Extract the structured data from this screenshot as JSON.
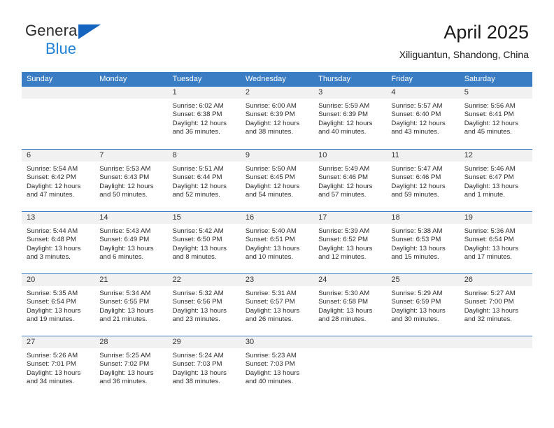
{
  "brand": {
    "line1": "General",
    "line2": "Blue",
    "triangle_color": "#1565c0",
    "blue_color": "#1f82d6"
  },
  "header": {
    "title": "April 2025",
    "subtitle": "Xiliguantun, Shandong, China"
  },
  "theme": {
    "header_blue": "#3b7dc4",
    "daynum_band": "#f1f1f1",
    "text": "#1a1a1a"
  },
  "weekdays": [
    "Sunday",
    "Monday",
    "Tuesday",
    "Wednesday",
    "Thursday",
    "Friday",
    "Saturday"
  ],
  "weeks": [
    [
      {
        "day": "",
        "lines": []
      },
      {
        "day": "",
        "lines": []
      },
      {
        "day": "1",
        "lines": [
          "Sunrise: 6:02 AM",
          "Sunset: 6:38 PM",
          "Daylight: 12 hours",
          "and 36 minutes."
        ]
      },
      {
        "day": "2",
        "lines": [
          "Sunrise: 6:00 AM",
          "Sunset: 6:39 PM",
          "Daylight: 12 hours",
          "and 38 minutes."
        ]
      },
      {
        "day": "3",
        "lines": [
          "Sunrise: 5:59 AM",
          "Sunset: 6:39 PM",
          "Daylight: 12 hours",
          "and 40 minutes."
        ]
      },
      {
        "day": "4",
        "lines": [
          "Sunrise: 5:57 AM",
          "Sunset: 6:40 PM",
          "Daylight: 12 hours",
          "and 43 minutes."
        ]
      },
      {
        "day": "5",
        "lines": [
          "Sunrise: 5:56 AM",
          "Sunset: 6:41 PM",
          "Daylight: 12 hours",
          "and 45 minutes."
        ]
      }
    ],
    [
      {
        "day": "6",
        "lines": [
          "Sunrise: 5:54 AM",
          "Sunset: 6:42 PM",
          "Daylight: 12 hours",
          "and 47 minutes."
        ]
      },
      {
        "day": "7",
        "lines": [
          "Sunrise: 5:53 AM",
          "Sunset: 6:43 PM",
          "Daylight: 12 hours",
          "and 50 minutes."
        ]
      },
      {
        "day": "8",
        "lines": [
          "Sunrise: 5:51 AM",
          "Sunset: 6:44 PM",
          "Daylight: 12 hours",
          "and 52 minutes."
        ]
      },
      {
        "day": "9",
        "lines": [
          "Sunrise: 5:50 AM",
          "Sunset: 6:45 PM",
          "Daylight: 12 hours",
          "and 54 minutes."
        ]
      },
      {
        "day": "10",
        "lines": [
          "Sunrise: 5:49 AM",
          "Sunset: 6:46 PM",
          "Daylight: 12 hours",
          "and 57 minutes."
        ]
      },
      {
        "day": "11",
        "lines": [
          "Sunrise: 5:47 AM",
          "Sunset: 6:46 PM",
          "Daylight: 12 hours",
          "and 59 minutes."
        ]
      },
      {
        "day": "12",
        "lines": [
          "Sunrise: 5:46 AM",
          "Sunset: 6:47 PM",
          "Daylight: 13 hours",
          "and 1 minute."
        ]
      }
    ],
    [
      {
        "day": "13",
        "lines": [
          "Sunrise: 5:44 AM",
          "Sunset: 6:48 PM",
          "Daylight: 13 hours",
          "and 3 minutes."
        ]
      },
      {
        "day": "14",
        "lines": [
          "Sunrise: 5:43 AM",
          "Sunset: 6:49 PM",
          "Daylight: 13 hours",
          "and 6 minutes."
        ]
      },
      {
        "day": "15",
        "lines": [
          "Sunrise: 5:42 AM",
          "Sunset: 6:50 PM",
          "Daylight: 13 hours",
          "and 8 minutes."
        ]
      },
      {
        "day": "16",
        "lines": [
          "Sunrise: 5:40 AM",
          "Sunset: 6:51 PM",
          "Daylight: 13 hours",
          "and 10 minutes."
        ]
      },
      {
        "day": "17",
        "lines": [
          "Sunrise: 5:39 AM",
          "Sunset: 6:52 PM",
          "Daylight: 13 hours",
          "and 12 minutes."
        ]
      },
      {
        "day": "18",
        "lines": [
          "Sunrise: 5:38 AM",
          "Sunset: 6:53 PM",
          "Daylight: 13 hours",
          "and 15 minutes."
        ]
      },
      {
        "day": "19",
        "lines": [
          "Sunrise: 5:36 AM",
          "Sunset: 6:54 PM",
          "Daylight: 13 hours",
          "and 17 minutes."
        ]
      }
    ],
    [
      {
        "day": "20",
        "lines": [
          "Sunrise: 5:35 AM",
          "Sunset: 6:54 PM",
          "Daylight: 13 hours",
          "and 19 minutes."
        ]
      },
      {
        "day": "21",
        "lines": [
          "Sunrise: 5:34 AM",
          "Sunset: 6:55 PM",
          "Daylight: 13 hours",
          "and 21 minutes."
        ]
      },
      {
        "day": "22",
        "lines": [
          "Sunrise: 5:32 AM",
          "Sunset: 6:56 PM",
          "Daylight: 13 hours",
          "and 23 minutes."
        ]
      },
      {
        "day": "23",
        "lines": [
          "Sunrise: 5:31 AM",
          "Sunset: 6:57 PM",
          "Daylight: 13 hours",
          "and 26 minutes."
        ]
      },
      {
        "day": "24",
        "lines": [
          "Sunrise: 5:30 AM",
          "Sunset: 6:58 PM",
          "Daylight: 13 hours",
          "and 28 minutes."
        ]
      },
      {
        "day": "25",
        "lines": [
          "Sunrise: 5:29 AM",
          "Sunset: 6:59 PM",
          "Daylight: 13 hours",
          "and 30 minutes."
        ]
      },
      {
        "day": "26",
        "lines": [
          "Sunrise: 5:27 AM",
          "Sunset: 7:00 PM",
          "Daylight: 13 hours",
          "and 32 minutes."
        ]
      }
    ],
    [
      {
        "day": "27",
        "lines": [
          "Sunrise: 5:26 AM",
          "Sunset: 7:01 PM",
          "Daylight: 13 hours",
          "and 34 minutes."
        ]
      },
      {
        "day": "28",
        "lines": [
          "Sunrise: 5:25 AM",
          "Sunset: 7:02 PM",
          "Daylight: 13 hours",
          "and 36 minutes."
        ]
      },
      {
        "day": "29",
        "lines": [
          "Sunrise: 5:24 AM",
          "Sunset: 7:03 PM",
          "Daylight: 13 hours",
          "and 38 minutes."
        ]
      },
      {
        "day": "30",
        "lines": [
          "Sunrise: 5:23 AM",
          "Sunset: 7:03 PM",
          "Daylight: 13 hours",
          "and 40 minutes."
        ]
      },
      {
        "day": "",
        "lines": []
      },
      {
        "day": "",
        "lines": []
      },
      {
        "day": "",
        "lines": []
      }
    ]
  ]
}
